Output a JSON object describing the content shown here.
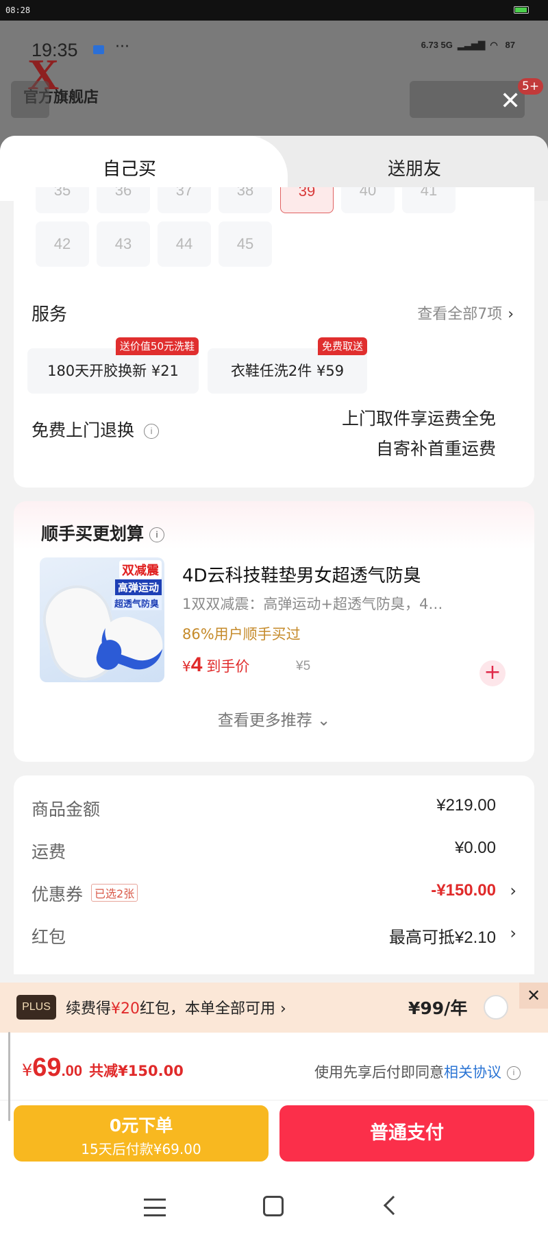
{
  "outer_status": {
    "time": "08:28"
  },
  "background_page": {
    "time": "19:35",
    "network": "6.73 5G",
    "battery": "87",
    "store_name": "官方旗舰店",
    "badge": "5+"
  },
  "tabs": [
    {
      "label": "自己买",
      "active": true
    },
    {
      "label": "送朋友",
      "active": false
    }
  ],
  "sizes": {
    "row1": [
      "35",
      "36",
      "37",
      "38",
      "39",
      "40",
      "41"
    ],
    "row2": [
      "42",
      "43",
      "44",
      "45"
    ],
    "selected": "39"
  },
  "services": {
    "title": "服务",
    "view_all": "查看全部7项",
    "items": [
      {
        "label": "180天开胶换新 ¥21",
        "tag": "送价值50元洗鞋"
      },
      {
        "label": "衣鞋任洗2件 ¥59",
        "tag": "免费取送"
      }
    ]
  },
  "free_return": {
    "title": "免费上门退换",
    "line1": "上门取件享运费全免",
    "line2": "自寄补首重运费"
  },
  "recommend": {
    "title": "顺手买更划算",
    "product": {
      "name": "4D云科技鞋垫男女超透气防臭",
      "desc": "1双双减震：高弹运动+超透气防臭，4…",
      "bought": "86%用户顺手买过",
      "price_currency": "¥",
      "price": "4",
      "price_label": "到手价",
      "original_price": "¥5",
      "img_text1": "双减震",
      "img_text2": "高弹运动",
      "img_text3": "超透气防臭"
    },
    "more": "查看更多推荐 ⌄"
  },
  "pricing": {
    "rows": [
      {
        "label": "商品金额",
        "value": "¥219.00"
      },
      {
        "label": "运费",
        "value": "¥0.00"
      },
      {
        "label": "优惠券",
        "tag": "已选2张",
        "value": "-¥150.00"
      },
      {
        "label": "红包",
        "value": "最高可抵¥2.10"
      }
    ]
  },
  "plus": {
    "badge": "PLUS",
    "text_pre": "续费得",
    "text_hl": "¥20",
    "text_post": "红包，本单全部可用 ›",
    "price": "¥99/年"
  },
  "summary": {
    "currency": "¥",
    "total_int": "69",
    "total_dec": ".00",
    "saved": "共减¥150.00",
    "agree_text": "使用先享后付即同意",
    "agree_link": "相关协议"
  },
  "buttons": {
    "later_line1": "0元下单",
    "later_line2": "15天后付款¥69.00",
    "pay": "普通支付"
  },
  "colors": {
    "accent_red": "#fb2f4a",
    "price_red": "#e02a2a",
    "later_yellow": "#f8b820",
    "link_blue": "#2a74d4"
  }
}
